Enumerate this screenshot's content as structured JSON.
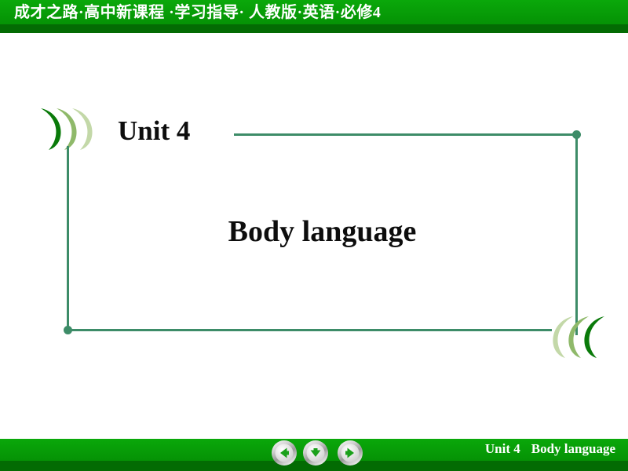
{
  "header": {
    "title": "成才之路·高中新课程 ·学习指导· 人教版·英语·必修4",
    "bright_green": "#0aa80a",
    "dark_green": "#036b03"
  },
  "slide": {
    "unit_label": "Unit 4",
    "main_title": "Body language",
    "frame_color": "#3d8c68",
    "text_color": "#0d0d0d"
  },
  "decor": {
    "chevron_dark": "#0a7a0a",
    "chevron_mid": "#8fb96a",
    "chevron_light": "#c3d8a8",
    "left_cluster_name": "left-chevron-decoration",
    "right_cluster_name": "right-chevron-decoration"
  },
  "footer": {
    "caption_unit": "Unit 4",
    "caption_title": "Body language",
    "bright_green": "#0aa80a",
    "dark_green": "#036b03",
    "nav": {
      "prev_icon": "arrow-left-icon",
      "down_icon": "arrow-down-icon",
      "next_icon": "arrow-right-icon"
    }
  }
}
